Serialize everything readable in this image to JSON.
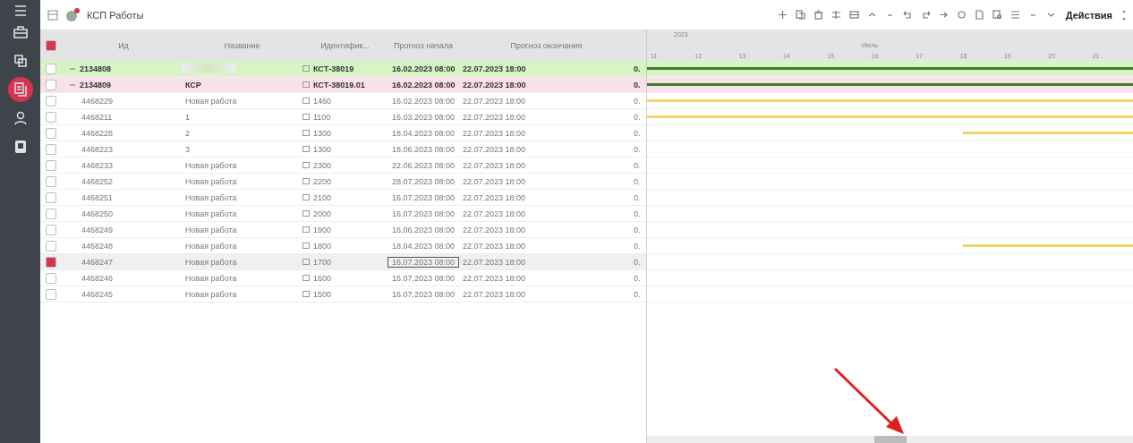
{
  "title": "КСП Работы",
  "toolbar": {
    "actions_label": "Действия"
  },
  "sidebar": {
    "items": [
      {
        "kind": "briefcase",
        "selected": false
      },
      {
        "kind": "copy",
        "selected": false
      },
      {
        "kind": "docs",
        "selected": true
      },
      {
        "kind": "person",
        "selected": false
      },
      {
        "kind": "page",
        "selected": false
      }
    ]
  },
  "table": {
    "select_all_checked": true,
    "columns": [
      "Ид",
      "Название",
      "Идентифик...",
      "Прогноз начала",
      "Прогноз окончания"
    ],
    "rows": [
      {
        "id": "2134808",
        "redacted": true,
        "ident": "КСТ-38019",
        "start": "16.02.2023 08:00",
        "end": "22.07.2023 18:00",
        "column_6": "0.",
        "color": "#d7f5c4",
        "checked": false,
        "selected": false,
        "expanded": true,
        "bar": {
          "color": "#3d7a2a",
          "kind": "full"
        }
      },
      {
        "id": "2134809",
        "name": "КСР",
        "ident": "КСТ-38019.01",
        "start": "16.02.2023 08:00",
        "end": "22.07.2023 18:00",
        "column_6": "0.",
        "color": "#f8e1e7",
        "checked": false,
        "selected": false,
        "expanded": true,
        "bar": {
          "color": "#3d7a2a",
          "kind": "full"
        },
        "children": [
          {
            "id": "4468229",
            "name": "Новая работа",
            "ident": "1460",
            "start": "16.02.2023 08:00",
            "end": "22.07.2023 18:00",
            "column_6": "0.",
            "checked": false,
            "selected": false,
            "bar": {
              "color": "#f0d66a",
              "kind": "full"
            }
          },
          {
            "id": "4468211",
            "name": "1",
            "ident": "1100",
            "start": "16.03.2023 08:00",
            "end": "22.07.2023 18:00",
            "column_6": "0.",
            "checked": false,
            "selected": false,
            "bar": {
              "color": "#f0d66a",
              "kind": "full"
            }
          },
          {
            "id": "4468228",
            "name": "2",
            "ident": "1300",
            "start": "18.04.2023 08:00",
            "end": "22.07.2023 18:00",
            "column_6": "0.",
            "checked": false,
            "selected": false,
            "bar": {
              "color": "#f0d66a",
              "kind": "tail"
            }
          },
          {
            "id": "4468223",
            "name": "3",
            "ident": "1300",
            "start": "18.06.2023 08:00",
            "end": "22.07.2023 18:00",
            "column_6": "0.",
            "checked": false,
            "selected": false
          },
          {
            "id": "4468233",
            "name": "Новая работа",
            "ident": "2300",
            "start": "22.06.2023 08:00",
            "end": "22.07.2023 18:00",
            "column_6": "0.",
            "checked": false,
            "selected": false
          },
          {
            "id": "4468252",
            "name": "Новая работа",
            "ident": "2200",
            "start": "28.07.2023 08:00",
            "end": "22.07.2023 18:00",
            "column_6": "0.",
            "checked": false,
            "selected": false
          },
          {
            "id": "4468251",
            "name": "Новая работа",
            "ident": "2100",
            "start": "16.07.2023 08:00",
            "end": "22.07.2023 18:00",
            "column_6": "0.",
            "checked": false,
            "selected": false
          },
          {
            "id": "4468250",
            "name": "Новая работа",
            "ident": "2000",
            "start": "16.07.2023 08:00",
            "end": "22.07.2023 18:00",
            "column_6": "0.",
            "checked": false,
            "selected": false
          },
          {
            "id": "4468249",
            "name": "Новая работа",
            "ident": "1900",
            "start": "16.06.2023 08:00",
            "end": "22.07.2023 18:00",
            "column_6": "0.",
            "checked": false,
            "selected": false
          },
          {
            "id": "4468248",
            "name": "Новая работа",
            "ident": "1800",
            "start": "18.04.2023 08:00",
            "end": "22.07.2023 18:00",
            "column_6": "0.",
            "checked": false,
            "selected": false,
            "bar": {
              "color": "#f0d66a",
              "kind": "tail"
            }
          },
          {
            "id": "4468247",
            "name": "Новая работа",
            "ident": "1700",
            "start": "16.07.2023 08:00",
            "end": "22.07.2023 18:00",
            "column_6": "0.",
            "checked": true,
            "selected": true
          },
          {
            "id": "4468246",
            "name": "Новая работа",
            "ident": "1600",
            "start": "16.07.2023 08:00",
            "end": "22.07.2023 18:00",
            "column_6": "0.",
            "checked": false,
            "selected": false
          },
          {
            "id": "4468245",
            "name": "Новая работа",
            "ident": "1500",
            "start": "16.07.2023 08:00",
            "end": "22.07.2023 18:00",
            "column_6": "0.",
            "checked": false,
            "selected": false
          }
        ]
      }
    ]
  },
  "gantt": {
    "year": "2023",
    "month": "Июль",
    "days": [
      "11",
      "12",
      "13",
      "14",
      "15",
      "16",
      "17",
      "18",
      "19",
      "20",
      "21"
    ]
  }
}
